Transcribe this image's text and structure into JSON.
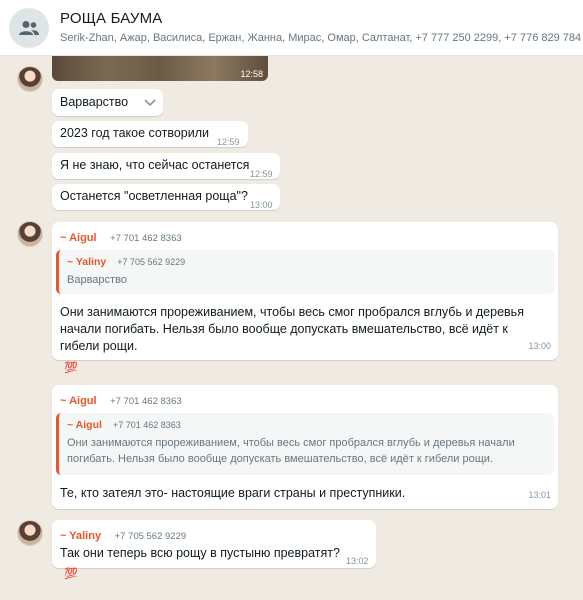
{
  "header": {
    "title": "РОЩА БАУМА",
    "members": "Serik-Zhan, Ажар, Василиса, Ержан, Жанна, Мирас, Омар, Салтанат, +7 777 250 2299, +7 776 829 784"
  },
  "image_message": {
    "time": "12:58"
  },
  "messages": [
    {
      "text": "Варварство",
      "time": ""
    },
    {
      "text": "2023 год такое сотворили",
      "time": "12:59"
    },
    {
      "text": "Я не знаю, что сейчас останется",
      "time": "12:59"
    },
    {
      "text": "Останется \"осветленная роща\"?",
      "time": "13:00"
    }
  ],
  "reply1": {
    "sender": "~ Aigul",
    "phone": "+7 701 462 8363",
    "quote_sender": "~ Yaliny",
    "quote_phone": "+7 705 562 9229",
    "quote_text": "Варварство",
    "text": "Они занимаются прореживанием, чтобы весь смог пробрался вглубь и деревья начали погибать. Нельзя было вообще допускать вмешательство, всё идёт к гибели рощи.",
    "time": "13:00",
    "reaction": "💯"
  },
  "reply2": {
    "sender": "~ Aigul",
    "phone": "+7 701 462 8363",
    "quote_sender": "~ Aigul",
    "quote_phone": "+7 701 462 8363",
    "quote_text": "Они занимаются прореживанием, чтобы весь смог пробрался вглубь и деревья начали погибать. Нельзя было вообще допускать вмешательство, всё идёт к гибели рощи.",
    "text": "Те, кто затеял это- настоящие враги страны и преступники.",
    "time": "13:01"
  },
  "msg3": {
    "sender": "~ Yaliny",
    "phone": "+7 705 562 9229",
    "text": "Так они теперь всю рощу в пустыню превратят?",
    "time": "13:02",
    "reaction": "💯"
  },
  "colors": {
    "accent": "#e8572b",
    "background": "#efeae2",
    "bubble": "#ffffff"
  }
}
